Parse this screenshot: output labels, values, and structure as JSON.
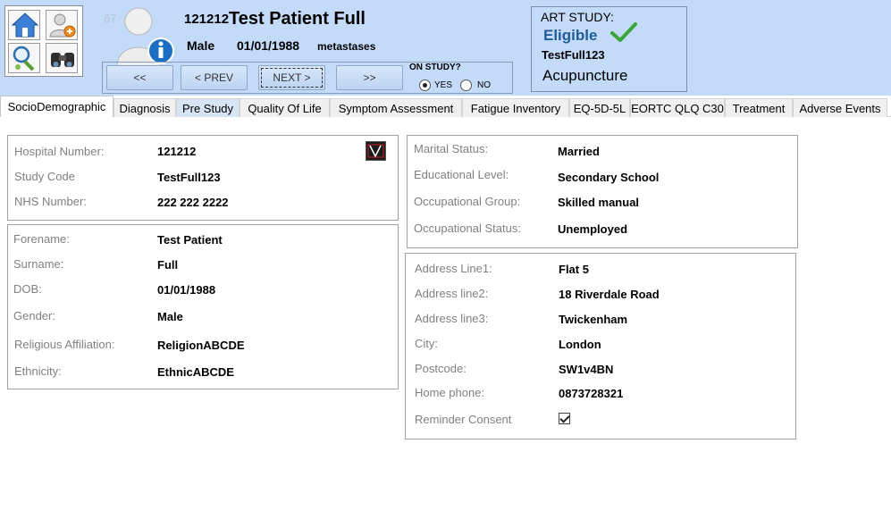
{
  "header": {
    "patient_count": "67",
    "hospital_number": "121212",
    "patient_name": "Test Patient Full",
    "gender": "Male",
    "dob": "01/01/1988",
    "diagnosis": "metastases",
    "toolbar_icons": [
      "home-icon",
      "add-user-icon",
      "search-icon",
      "binoculars-icon"
    ],
    "avatar_icon": "patient-avatar-info-icon"
  },
  "nav": {
    "first": "<<",
    "prev": "< PREV",
    "next": "NEXT >",
    "last": ">>",
    "on_study_label": "ON STUDY?",
    "yes_label": "YES",
    "no_label": "NO",
    "on_study_selected": "YES"
  },
  "art_study": {
    "title": "ART STUDY:",
    "status": "Eligible",
    "status_icon": "check-icon",
    "study_code": "TestFull123",
    "therapy": "Acupuncture"
  },
  "tabs": [
    {
      "label": "SocioDemographic",
      "active": true
    },
    {
      "label": "Diagnosis"
    },
    {
      "label": "Pre Study"
    },
    {
      "label": "Quality Of Life"
    },
    {
      "label": "Symptom Assessment"
    },
    {
      "label": "Fatigue Inventory"
    },
    {
      "label": "EQ-5D-5L"
    },
    {
      "label": "EORTC QLQ C30"
    },
    {
      "label": "Treatment"
    },
    {
      "label": "Adverse Events"
    }
  ],
  "ids": {
    "hospital_number": {
      "label": "Hospital Number:",
      "value": "121212"
    },
    "study_code": {
      "label": "Study Code",
      "value": "TestFull123"
    },
    "nhs_number": {
      "label": "NHS Number:",
      "value": "222 222 2222"
    }
  },
  "personal": {
    "forename": {
      "label": "Forename:",
      "value": "Test Patient"
    },
    "surname": {
      "label": "Surname:",
      "value": "Full"
    },
    "dob": {
      "label": "DOB:",
      "value": "01/01/1988"
    },
    "gender": {
      "label": "Gender:",
      "value": "Male"
    },
    "religion": {
      "label": "Religious Affiliation:",
      "value": "ReligionABCDE"
    },
    "ethnicity": {
      "label": "Ethnicity:",
      "value": "EthnicABCDE"
    }
  },
  "social": {
    "marital": {
      "label": "Marital Status:",
      "value": "Married"
    },
    "education": {
      "label": "Educational Level:",
      "value": "Secondary School"
    },
    "occ_group": {
      "label": "Occupational Group:",
      "value": "Skilled manual"
    },
    "occ_status": {
      "label": "Occupational Status:",
      "value": "Unemployed"
    }
  },
  "address": {
    "line1": {
      "label": "Address Line1:",
      "value": "Flat 5"
    },
    "line2": {
      "label": "Address line2:",
      "value": "18 Riverdale Road"
    },
    "line3": {
      "label": "Address line3:",
      "value": "Twickenham"
    },
    "city": {
      "label": "City:",
      "value": "London"
    },
    "postcode": {
      "label": "Postcode:",
      "value": "SW1v4BN"
    },
    "home_phone": {
      "label": "Home phone:",
      "value": "0873728321"
    },
    "reminder": {
      "label": "Reminder Consent",
      "checked": true
    }
  },
  "colors": {
    "header_bg": "#c3daf9",
    "eligible_text": "#1f5d99",
    "check_green": "#3aa53a"
  }
}
